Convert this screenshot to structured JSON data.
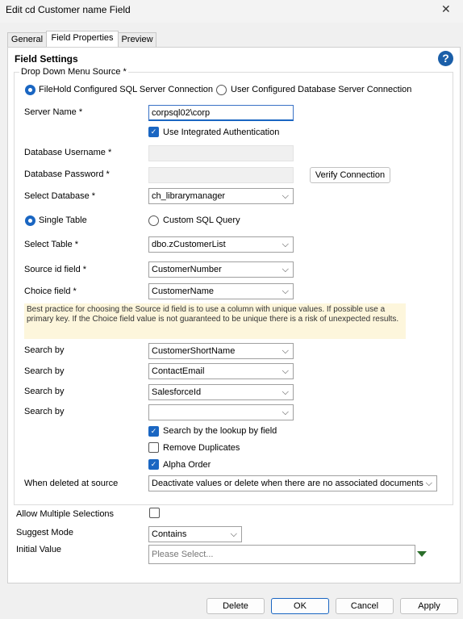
{
  "window": {
    "title": "Edit cd Customer name Field",
    "close_glyph": "✕"
  },
  "tabs": [
    "General",
    "Field Properties",
    "Preview"
  ],
  "section_title": "Field Settings",
  "group_title": "Drop Down Menu Source *",
  "source": {
    "option1": "FileHold Configured SQL Server Connection",
    "option2": "User Configured Database Server Connection",
    "selected": "option1"
  },
  "labels": {
    "server_name": "Server Name *",
    "db_username": "Database Username *",
    "db_password": "Database Password *",
    "select_database": "Select Database *",
    "select_table": "Select Table *",
    "source_id": "Source id field *",
    "choice_field": "Choice field *",
    "search_by": "Search by",
    "when_deleted": "When deleted at source",
    "allow_multiple": "Allow Multiple Selections",
    "suggest_mode": "Suggest Mode",
    "initial_value": "Initial Value"
  },
  "values": {
    "server_name": "corpsql02\\corp",
    "database": "ch_librarymanager",
    "table": "dbo.zCustomerList",
    "source_id": "CustomerNumber",
    "choice_field": "CustomerName",
    "search_by": [
      "CustomerShortName",
      "ContactEmail",
      "SalesforceId",
      ""
    ],
    "when_deleted": "Deactivate values or delete when there are no associated documents",
    "suggest_mode": "Contains",
    "initial_value_placeholder": "Please Select..."
  },
  "checkboxes": {
    "integrated_auth": {
      "label": "Use Integrated Authentication",
      "checked": true
    },
    "search_lookup": {
      "label": "Search by the lookup by field",
      "checked": true
    },
    "remove_duplicates": {
      "label": "Remove Duplicates",
      "checked": false
    },
    "alpha_order": {
      "label": "Alpha Order",
      "checked": true
    },
    "allow_multiple": {
      "checked": false
    }
  },
  "query_type": {
    "option1": "Single Table",
    "option2": "Custom SQL Query",
    "selected": "option1"
  },
  "note": "Best practice for choosing the Source id field is to use a column with unique values. If possible use a primary key. If the Choice field value is not guaranteed to be unique there is a risk of unexpected results.",
  "buttons": {
    "verify": "Verify Connection",
    "delete": "Delete",
    "ok": "OK",
    "cancel": "Cancel",
    "apply": "Apply"
  },
  "icons": {
    "help": "?",
    "chevron": "⌵",
    "check": "✓"
  },
  "colors": {
    "accent": "#1a66c2",
    "help": "#1a5ea8",
    "note_bg": "#fdf6dc",
    "triangle": "#2b6e2b"
  }
}
